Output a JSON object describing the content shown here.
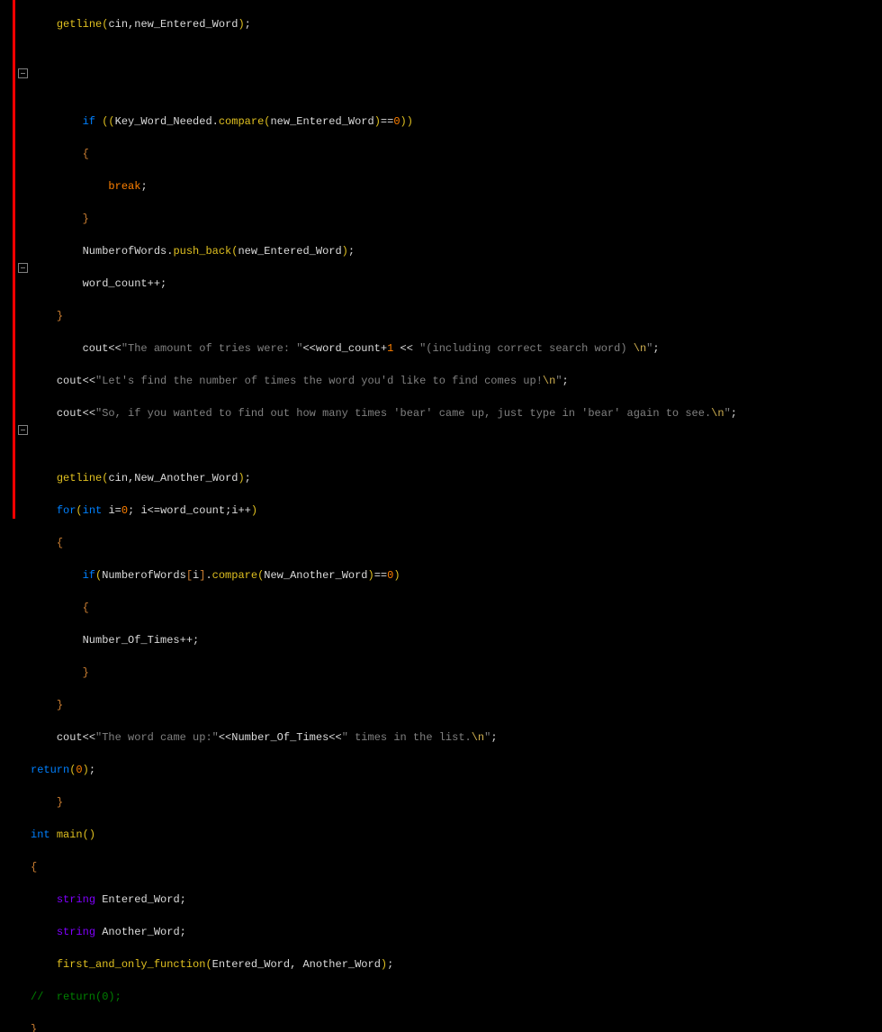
{
  "code": {
    "lines": [
      "    getline(cin,new_Entered_Word);",
      "",
      "",
      "        if ((Key_Word_Needed.compare(new_Entered_Word)==0))",
      "        {",
      "            break;",
      "        }",
      "        NumberofWords.push_back(new_Entered_Word);",
      "        word_count++;",
      "    }",
      "        cout<<\"The amount of tries were: \"<<word_count+1 << \"(including correct search word) \\n\";",
      "    cout<<\"Let's find the number of times the word you'd like to find comes up!\\n\";",
      "    cout<<\"So, if you wanted to find out how many times 'bear' came up, just type in 'bear' again to see.\\n\";",
      "",
      "    getline(cin,New_Another_Word);",
      "    for(int i=0; i<=word_count;i++)",
      "    {",
      "        if(NumberofWords[i].compare(New_Another_Word)==0)",
      "        {",
      "        Number_Of_Times++;",
      "        }",
      "    }",
      "    cout<<\"The word came up:\"<<Number_Of_Times<<\" times in the list.\\n\";",
      "return(0);",
      "    }",
      "int main()",
      "{",
      "    string Entered_Word;",
      "    string Another_Word;",
      "    first_and_only_function(Entered_Word, Another_Word);",
      "//  return(0);",
      "}"
    ]
  },
  "t": {
    "getline": "getline",
    "cin": "cin",
    "new_Entered_Word": "new_Entered_Word",
    "if": "if",
    "Key_Word_Needed": "Key_Word_Needed",
    "compare": "compare",
    "eqeq": "==",
    "zero": "0",
    "break": "break",
    "NumberofWords": "NumberofWords",
    "push_back": "push_back",
    "word_count": "word_count",
    "plusplus": "++",
    "cout": "cout",
    "ltlt": "<<",
    "s1": "\"The amount of tries were: \"",
    "plus1": "+",
    "one": "1",
    "s2": "\"(including correct search word) ",
    "nEsc": "\\n",
    "qend": "\"",
    "semi": ";",
    "s3": "\"Let's find the number of times the word you'd like to find comes up!",
    "s4": "\"So, if you wanted to find out how many times 'bear' came up, just type in 'bear' again to see.",
    "New_Another_Word": "New_Another_Word",
    "for": "for",
    "int": "int",
    "i": "i",
    "eq": "=",
    "le": "<=",
    "Number_Of_Times": "Number_Of_Times",
    "s5": "\"The word came up:\"",
    "s6": "\" times in the list.",
    "return": "return",
    "ret0": "(",
    "zero2": "0",
    "retc": ")",
    "main": "main",
    "string": "string",
    "Entered_Word": "Entered_Word",
    "Another_Word": "Another_Word",
    "faof": "first_and_only_function",
    "comret": "//  return(0);",
    "ob": "{",
    "cb": "}",
    "op": "(",
    "cp": ")",
    "osb": "[",
    "csb": "]",
    "comma": ",",
    "dot": "."
  }
}
